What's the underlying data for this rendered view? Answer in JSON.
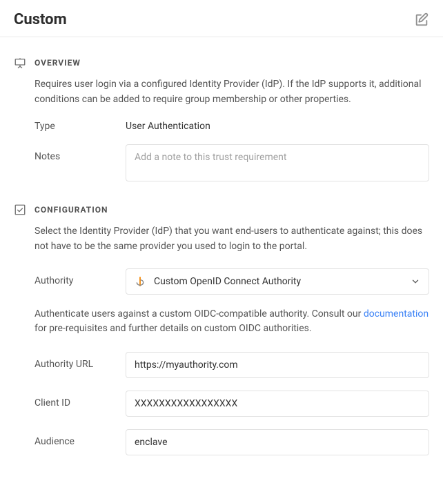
{
  "header": {
    "title": "Custom"
  },
  "overview": {
    "heading": "OVERVIEW",
    "description": "Requires user login via a configured Identity Provider (IdP). If the IdP supports it, additional conditions can be added to require group membership or other properties.",
    "type_label": "Type",
    "type_value": "User Authentication",
    "notes_label": "Notes",
    "notes_placeholder": "Add a note to this trust requirement",
    "notes_value": ""
  },
  "configuration": {
    "heading": "CONFIGURATION",
    "description": "Select the Identity Provider (IdP) that you want end-users to authenticate against; this does not have to be the same provider you used to login to the portal.",
    "authority_label": "Authority",
    "authority_selected": "Custom OpenID Connect Authority",
    "auth_note_prefix": "Authenticate users against a custom OIDC-compatible authority. Consult our ",
    "auth_note_link": "documentation",
    "auth_note_suffix": " for pre-requisites and further details on custom OIDC authorities.",
    "authority_url_label": "Authority URL",
    "authority_url_value": "https://myauthority.com",
    "client_id_label": "Client ID",
    "client_id_value": "XXXXXXXXXXXXXXXXX",
    "audience_label": "Audience",
    "audience_value": "enclave"
  }
}
